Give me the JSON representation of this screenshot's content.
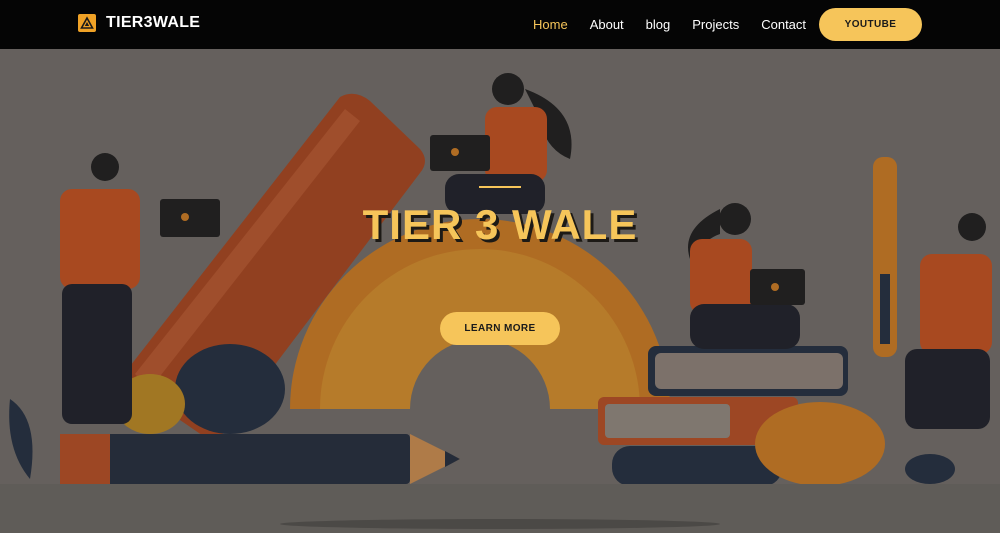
{
  "brand": {
    "name": "TIER3WALE",
    "logo_icon": "triangle-logo-icon"
  },
  "nav": {
    "items": [
      {
        "label": "Home",
        "active": true
      },
      {
        "label": "About",
        "active": false
      },
      {
        "label": "blog",
        "active": false
      },
      {
        "label": "Projects",
        "active": false
      },
      {
        "label": "Contact",
        "active": false
      }
    ],
    "youtube_label": "YOUTUBE"
  },
  "hero": {
    "title": "TIER 3 WALE",
    "button_label": "LEARN MORE",
    "illustration": "students-with-laptops-and-school-supplies-illustration"
  },
  "colors": {
    "accent": "#f6c55a",
    "navbar": "#050505",
    "hero_overlay": "#6e6a66",
    "illustration_orange": "#c4571f",
    "illustration_navy": "#1f2b3d"
  }
}
